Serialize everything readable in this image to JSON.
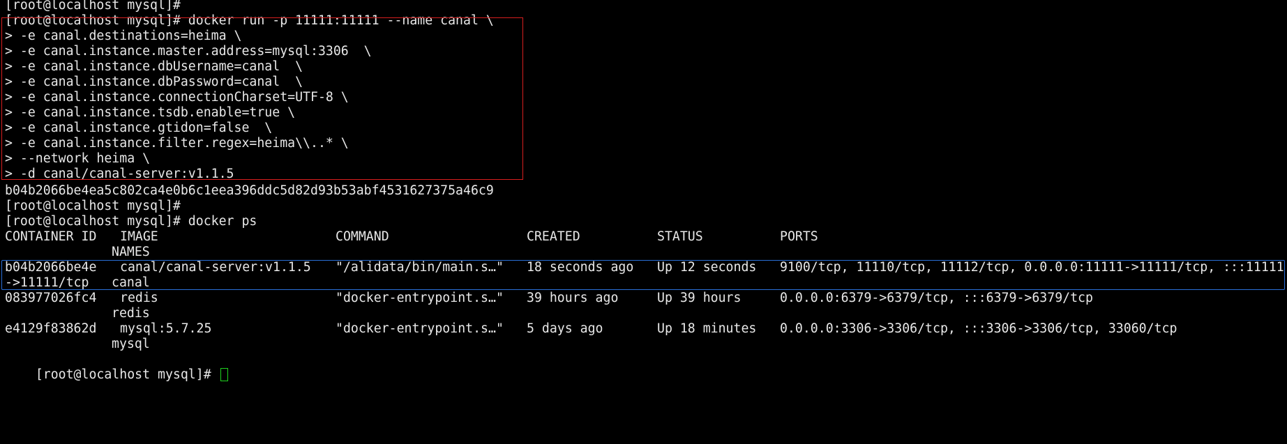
{
  "terminal": {
    "top_prompt": "[root@localhost mysql]#",
    "command_lines": [
      "[root@localhost mysql]# docker run -p 11111:11111 --name canal \\",
      "> -e canal.destinations=heima \\",
      "> -e canal.instance.master.address=mysql:3306  \\",
      "> -e canal.instance.dbUsername=canal  \\",
      "> -e canal.instance.dbPassword=canal  \\",
      "> -e canal.instance.connectionCharset=UTF-8 \\",
      "> -e canal.instance.tsdb.enable=true \\",
      "> -e canal.instance.gtidon=false  \\",
      "> -e canal.instance.filter.regex=heima\\\\..* \\",
      "> --network heima \\",
      "> -d canal/canal-server:v1.1.5"
    ],
    "container_hash": "b04b2066be4ea5c802ca4e0b6c1eea396ddc5d82d93b53abf4531627375a46c9",
    "prompt_after_run": "[root@localhost mysql]#",
    "ps_command": "[root@localhost mysql]# docker ps",
    "ps_headers": {
      "container_id": "CONTAINER ID",
      "image": "IMAGE",
      "command": "COMMAND",
      "created": "CREATED",
      "status": "STATUS",
      "ports": "PORTS",
      "names": "NAMES"
    },
    "containers": [
      {
        "id": "b04b2066be4e",
        "image": "canal/canal-server:v1.1.5",
        "command": "\"/alidata/bin/main.s…\"",
        "created": "18 seconds ago",
        "status": "Up 12 seconds",
        "ports": "9100/tcp, 11110/tcp, 11112/tcp, 0.0.0.0:11111->11111/tcp, :::11111",
        "ports_wrap": "->11111/tcp",
        "name": "canal"
      },
      {
        "id": "083977026fc4",
        "image": "redis",
        "command": "\"docker-entrypoint.s…\"",
        "created": "39 hours ago",
        "status": "Up 39 hours",
        "ports": "0.0.0.0:6379->6379/tcp, :::6379->6379/tcp",
        "ports_wrap": "",
        "name": "redis"
      },
      {
        "id": "e4129f83862d",
        "image": "mysql:5.7.25",
        "command": "\"docker-entrypoint.s…\"",
        "created": "5 days ago",
        "status": "Up 18 minutes",
        "ports": "0.0.0.0:3306->3306/tcp, :::3306->3306/tcp, 33060/tcp",
        "ports_wrap": "",
        "name": "mysql"
      }
    ],
    "final_prompt": "[root@localhost mysql]#",
    "colors": {
      "background": "#000000",
      "text": "#e8e8e8",
      "cursor": "#1fd21f",
      "highlight_command": "#d81e1e",
      "highlight_row": "#2a6fd8"
    }
  }
}
